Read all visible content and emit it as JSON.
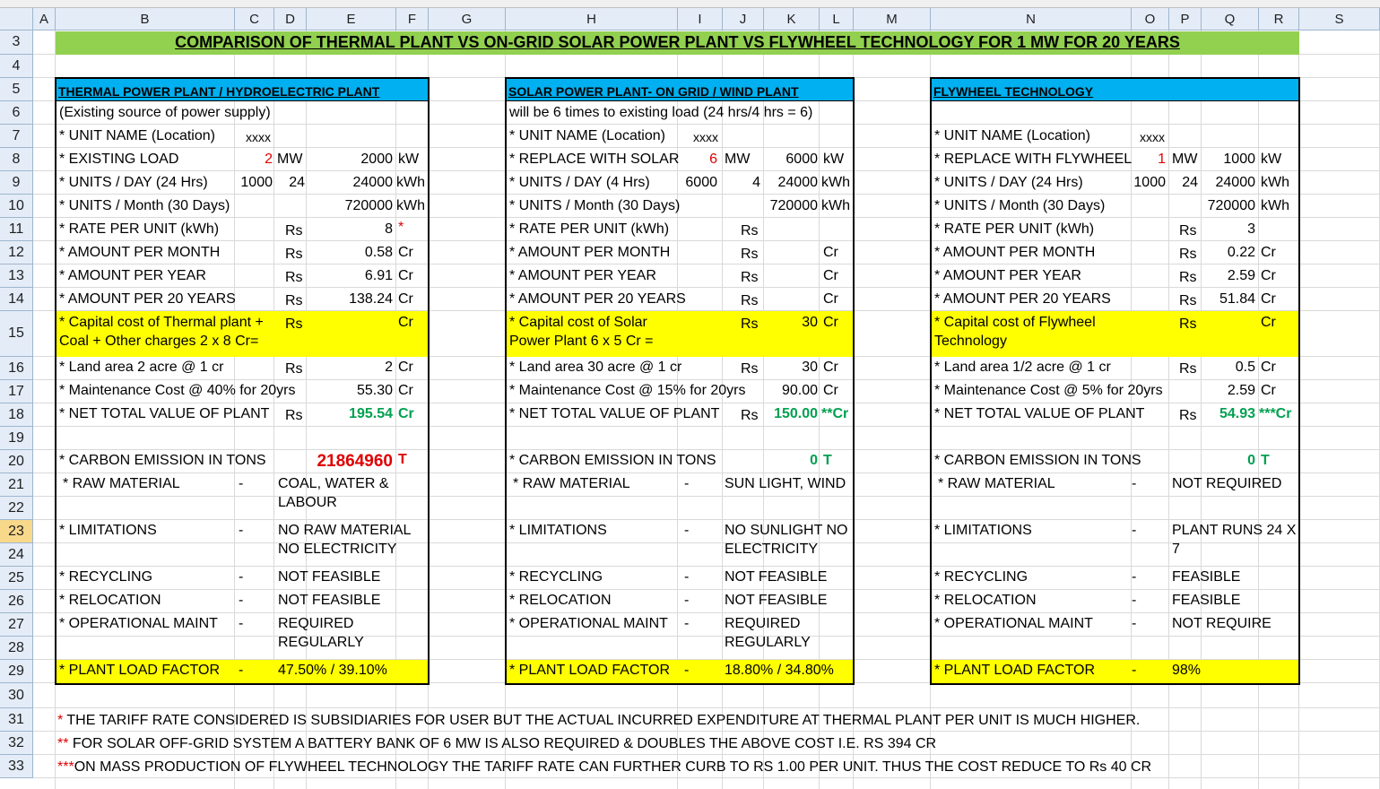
{
  "columns": [
    "A",
    "B",
    "C",
    "D",
    "E",
    "F",
    "G",
    "H",
    "I",
    "J",
    "K",
    "L",
    "M",
    "N",
    "O",
    "P",
    "Q",
    "R",
    "S"
  ],
  "rows": [
    "3",
    "4",
    "5",
    "6",
    "7",
    "8",
    "9",
    "10",
    "11",
    "12",
    "13",
    "14",
    "15",
    "16",
    "17",
    "18",
    "19",
    "20",
    "21",
    "22",
    "23",
    "24",
    "25",
    "26",
    "27",
    "28",
    "29",
    "30",
    "31",
    "32",
    "33"
  ],
  "title": "COMPARISON OF THERMAL PLANT VS ON-GRID SOLAR POWER PLANT VS FLYWHEEL TECHNOLOGY FOR 1 MW FOR 20 YEARS",
  "thermal": {
    "header": "THERMAL POWER PLANT  / HYDROELECTRIC PLANT",
    "subtitle": "(Existing source of power supply)",
    "unit_name": "* UNIT NAME (Location)",
    "unit_val": "xxxx",
    "load_label": "* EXISTING LOAD",
    "load_mw": "2",
    "mw": "MW",
    "load_kw": "2000",
    "kw": "kW",
    "day_label": "* UNITS / DAY (24 Hrs)",
    "day_a": "1000",
    "day_b": "24",
    "day_kwh": "24000",
    "kwh": "kWh",
    "month_label": "* UNITS / Month (30 Days)",
    "month_kwh": "720000",
    "rate_label": "* RATE PER UNIT (kWh)",
    "rs": "Rs",
    "rate": "8",
    "rate_mark": "*",
    "apm_label": "* AMOUNT PER MONTH",
    "apm": "0.58",
    "cr": "Cr",
    "apy_label": "* AMOUNT PER YEAR",
    "apy": "6.91",
    "ap20_label": "* AMOUNT PER 20 YEARS",
    "ap20": "138.24",
    "cap_label1": "* Capital cost of Thermal plant +",
    "cap_label2": "Coal + Other charges 2 x 8 Cr=",
    "land_label": "* Land area  2 acre @ 1 cr",
    "land": "2",
    "maint_label": "* Maintenance Cost @ 40% for 20yrs",
    "maint": "55.30",
    "net_label": "* NET TOTAL VALUE OF PLANT",
    "net": "195.54",
    "net_cr": "Cr",
    "carbon_label": "* CARBON EMISSION IN TONS",
    "carbon": "21864960",
    "t": "T",
    "raw_label": "* RAW MATERIAL",
    "dash": "-",
    "raw1": "COAL, WATER &",
    "raw2": "LABOUR",
    "lim_label": "* LIMITATIONS",
    "lim1": "NO RAW MATERIAL",
    "lim2": "NO ELECTRICITY",
    "rec_label": "* RECYCLING",
    "rec": "NOT FEASIBLE",
    "rel_label": "* RELOCATION",
    "rel": "NOT FEASIBLE",
    "op_label": "* OPERATIONAL MAINT",
    "op1": "REQUIRED",
    "op2": "REGULARLY",
    "plf_label": "* PLANT LOAD FACTOR",
    "plf": "47.50% / 39.10%"
  },
  "solar": {
    "header": "SOLAR POWER PLANT- ON GRID / WIND PLANT",
    "subtitle": "will be 6 times to existing load (24 hrs/4 hrs = 6)",
    "unit_name": "* UNIT NAME (Location)",
    "unit_val": "xxxx",
    "load_label": "* REPLACE WITH SOLAR",
    "load_mw": "6",
    "mw": "MW",
    "load_kw": "6000",
    "kw": "kW",
    "day_label": "* UNITS / DAY (4 Hrs)",
    "day_a": "6000",
    "day_b": "4",
    "day_kwh": "24000",
    "kwh": "kWh",
    "month_label": "* UNITS / Month (30 Days)",
    "month_kwh": "720000",
    "rate_label": "* RATE PER UNIT (kWh)",
    "rs": "Rs",
    "apm_label": "* AMOUNT PER MONTH",
    "cr": "Cr",
    "apy_label": "* AMOUNT PER YEAR",
    "ap20_label": "* AMOUNT PER 20 YEARS",
    "cap_label1": "* Capital cost of Solar",
    "cap_label2": "Power Plant  6 x 5 Cr =",
    "cap": "30",
    "land_label": "* Land area  30 acre @ 1 cr",
    "land": "30",
    "maint_label": "* Maintenance Cost @ 15% for 20yrs",
    "maint": "90.00",
    "net_label": "* NET TOTAL VALUE OF PLANT",
    "net": "150.00",
    "net_cr": "**Cr",
    "carbon_label": "* CARBON EMISSION IN TONS",
    "carbon": "0",
    "t": "T",
    "raw_label": "* RAW MATERIAL",
    "dash": "-",
    "raw1": "SUN LIGHT, WIND",
    "lim_label": "* LIMITATIONS",
    "lim1": "NO SUNLIGHT NO",
    "lim2": "ELECTRICITY",
    "rec_label": "* RECYCLING",
    "rec": "NOT FEASIBLE",
    "rel_label": "* RELOCATION",
    "rel": "NOT FEASIBLE",
    "op_label": "* OPERATIONAL MAINT",
    "op1": "REQUIRED",
    "op2": "REGULARLY",
    "plf_label": "* PLANT LOAD FACTOR",
    "plf": "18.80% / 34.80%"
  },
  "fly": {
    "header": "FLYWHEEL TECHNOLOGY",
    "unit_name": "* UNIT NAME (Location)",
    "unit_val": "xxxx",
    "load_label": "* REPLACE WITH FLYWHEEL",
    "load_mw": "1",
    "mw": "MW",
    "load_kw": "1000",
    "kw": "kW",
    "day_label": "* UNITS / DAY (24 Hrs)",
    "day_a": "1000",
    "day_b": "24",
    "day_kwh": "24000",
    "kwh": "kWh",
    "month_label": "* UNITS / Month (30 Days)",
    "month_kwh": "720000",
    "rate_label": "* RATE PER UNIT (kWh)",
    "rs": "Rs",
    "rate": "3",
    "apm_label": "* AMOUNT PER MONTH",
    "apm": "0.22",
    "cr": "Cr",
    "apy_label": "* AMOUNT PER YEAR",
    "apy": "2.59",
    "ap20_label": "* AMOUNT PER 20 YEARS",
    "ap20": "51.84",
    "cap_label1": "* Capital cost of Flywheel",
    "cap_label2": "Technology",
    "land_label": "* Land area  1/2 acre @ 1 cr",
    "land": "0.5",
    "maint_label": "* Maintenance Cost @ 5% for 20yrs",
    "maint": "2.59",
    "net_label": "* NET TOTAL VALUE OF PLANT",
    "net": "54.93",
    "net_cr": "***Cr",
    "carbon_label": "* CARBON EMISSION IN TONS",
    "carbon": "0",
    "t": "T",
    "raw_label": "* RAW MATERIAL",
    "dash": "-",
    "raw1": "NOT REQUIRED",
    "lim_label": "* LIMITATIONS",
    "lim1": "PLANT RUNS 24 X",
    "lim2": "7",
    "rec_label": "* RECYCLING",
    "rec": "FEASIBLE",
    "rel_label": "* RELOCATION",
    "rel": "FEASIBLE",
    "op_label": "* OPERATIONAL MAINT",
    "op1": "NOT REQUIRE",
    "plf_label": "* PLANT LOAD FACTOR",
    "plf": "98%"
  },
  "notes": {
    "n1_mark": "*",
    "n1": " THE TARIFF RATE CONSIDERED IS SUBSIDIARIES FOR USER BUT THE ACTUAL INCURRED EXPENDITURE AT THERMAL PLANT PER UNIT IS MUCH HIGHER.",
    "n2_mark": "**",
    "n2": " FOR SOLAR OFF-GRID SYSTEM A BATTERY BANK OF 6 MW IS ALSO REQUIRED & DOUBLES THE ABOVE COST I.E. RS 394 CR",
    "n3_mark": "***",
    "n3": "ON MASS PRODUCTION OF FLYWHEEL TECHNOLOGY THE TARIFF RATE CAN FURTHER CURB TO RS 1.00 PER UNIT. THUS THE COST REDUCE TO Rs 40 CR"
  },
  "colors": {
    "title_bg": "#92d050",
    "header_bg": "#00b0f0",
    "highlight_bg": "#ffff00",
    "net_green": "#00a050",
    "red": "#e00000"
  }
}
